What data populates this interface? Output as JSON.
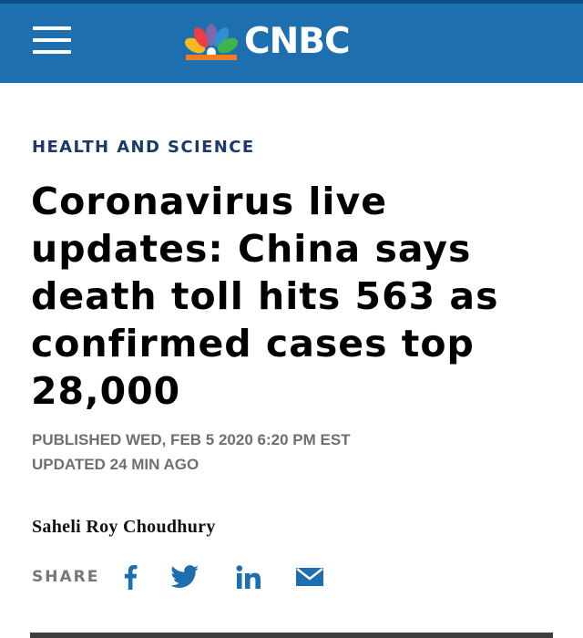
{
  "header": {
    "brand": "CNBC",
    "menu_icon": "hamburger-menu-icon",
    "logo_icon": "nbc-peacock-icon",
    "background_color": "#1e6fb0"
  },
  "article": {
    "section": "HEALTH AND SCIENCE",
    "headline": "Coronavirus live updates: China says death toll hits 563 as confirmed cases top 28,000",
    "published": "PUBLISHED WED, FEB 5 2020 6:20 PM EST",
    "updated": "UPDATED 24 MIN AGO",
    "author": "Saheli Roy Choudhury"
  },
  "share": {
    "label": "SHARE",
    "icons": [
      "facebook-icon",
      "twitter-icon",
      "linkedin-icon",
      "email-icon"
    ],
    "icon_color": "#1e6fb0"
  }
}
